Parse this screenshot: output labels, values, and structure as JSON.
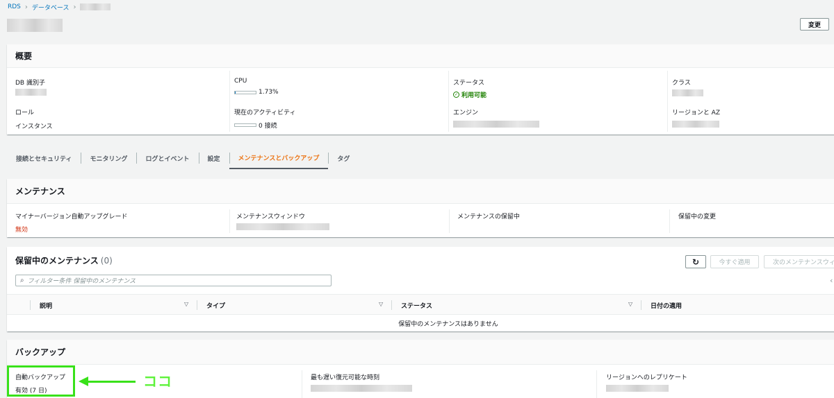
{
  "breadcrumb": {
    "rds": "RDS",
    "databases": "データベース"
  },
  "header": {
    "modify": "変更"
  },
  "summary": {
    "title": "概要",
    "db_id_label": "DB 識別子",
    "cpu_label": "CPU",
    "cpu_value": "1.73%",
    "status_label": "ステータス",
    "status_value": "利用可能",
    "class_label": "クラス",
    "role_label": "ロール",
    "role_value": "インスタンス",
    "activity_label": "現在のアクティビティ",
    "activity_value": "0 接続",
    "engine_label": "エンジン",
    "region_label": "リージョンと AZ"
  },
  "tabs": [
    {
      "label": "接続とセキュリティ"
    },
    {
      "label": "モニタリング"
    },
    {
      "label": "ログとイベント"
    },
    {
      "label": "設定"
    },
    {
      "label": "メンテナンスとバックアップ"
    },
    {
      "label": "タグ"
    }
  ],
  "maintenance": {
    "title": "メンテナンス",
    "auto_upgrade_label": "マイナーバージョン自動アップグレード",
    "auto_upgrade_value": "無効",
    "window_label": "メンテナンスウィンドウ",
    "pending_label": "メンテナンスの保留中",
    "pending_changes_label": "保留中の変更"
  },
  "pending_maintenance": {
    "title": "保留中のメンテナンス",
    "count": "(0)",
    "apply_now": "今すぐ適用",
    "apply_next": "次のメンテナンスウィ",
    "search_placeholder": "フィルター条件 保留中のメンテナンス",
    "columns": [
      "説明",
      "タイプ",
      "ステータス",
      "日付の適用"
    ],
    "empty": "保留中のメンテナンスはありません"
  },
  "backup": {
    "title": "バックアップ",
    "auto_label": "自動バックアップ",
    "auto_value": "有効 (7 日)",
    "latest_label": "最も遅い復元可能な時刻",
    "replicate_label": "リージョンへのレプリケート"
  },
  "annotation": {
    "text": "ココ",
    "color": "#39e11a"
  },
  "colors": {
    "link": "#0073bb",
    "active_tab": "#ec7211",
    "success": "#1d8102",
    "danger": "#d13212"
  }
}
